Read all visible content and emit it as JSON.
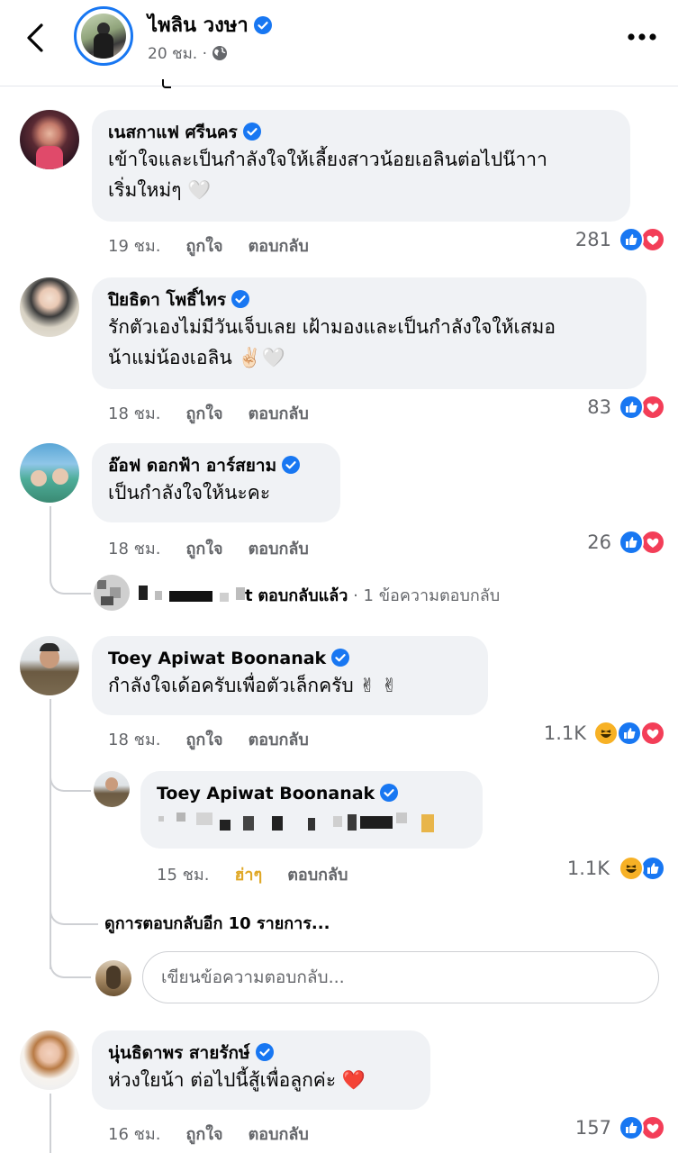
{
  "header": {
    "page_name": "ไพลิน วงษา",
    "time": "20 ชม.",
    "separator": " · "
  },
  "icons": {
    "back": "chevron-left-icon",
    "verified": "verified-badge-icon",
    "globe": "globe-icon",
    "more": "more-horizontal-icon",
    "like": "like-icon",
    "love": "love-icon",
    "haha": "haha-icon"
  },
  "colors": {
    "accent": "#1877f2",
    "love": "#f33e58",
    "haha": "#f7b125",
    "bubble": "#f0f2f5",
    "meta": "#65676b"
  },
  "comments": [
    {
      "name": "เนสกาแฟ ศรีนคร",
      "line1": "เข้าใจและเป็นกำลังใจให้เลี้ยงสาวน้อยเอลินต่อไปน๊าาา",
      "line2": "เริ่มใหม่ๆ 🤍",
      "time": "19 ชม.",
      "like": "ถูกใจ",
      "reply": "ตอบกลับ",
      "count": "281"
    },
    {
      "name": "ปิยธิดา โพธิ์ไทร",
      "line1": "รักตัวเองไม่มีวันเจ็บเลย เฝ้ามองและเป็นกำลังใจให้เสมอ",
      "line2": "น้าแม่น้องเอลิน ✌🏻🤍",
      "time": "18 ชม.",
      "like": "ถูกใจ",
      "reply": "ตอบกลับ",
      "count": "83"
    },
    {
      "name": "อ๊อฟ ดอกฟ้า อาร์สยาม",
      "line1": "เป็นกำลังใจให้นะคะ",
      "time": "18 ชม.",
      "like": "ถูกใจ",
      "reply": "ตอบกลับ",
      "count": "26",
      "replied_name_tail": "t",
      "replied_text": "ตอบกลับแล้ว",
      "replied_sub": " · 1 ข้อความตอบกลับ"
    },
    {
      "name": "Toey Apiwat Boonanak",
      "line1": "กำลังใจเด้อครับเพื่อตัวเล็กครับ ✌ ✌",
      "time": "18 ชม.",
      "like": "ถูกใจ",
      "reply": "ตอบกลับ",
      "count": "1.1K"
    },
    {
      "name": "Toey Apiwat Boonanak",
      "time": "15 ชม.",
      "like": "ฮ่าๆ",
      "reply": "ตอบกลับ",
      "count": "1.1K"
    },
    {
      "name": "นุ่นธิดาพร สายรักษ์",
      "line1": "ห่วงใยน้า ต่อไปนี้สู้เพื่อลูกค่ะ ❤️",
      "time": "16 ชม.",
      "like": "ถูกใจ",
      "reply": "ตอบกลับ",
      "count": "157"
    }
  ],
  "more_replies": "ดูการตอบกลับอีก 10 รายการ...",
  "reply_input": {
    "placeholder": "เขียนข้อความตอบกลับ..."
  }
}
